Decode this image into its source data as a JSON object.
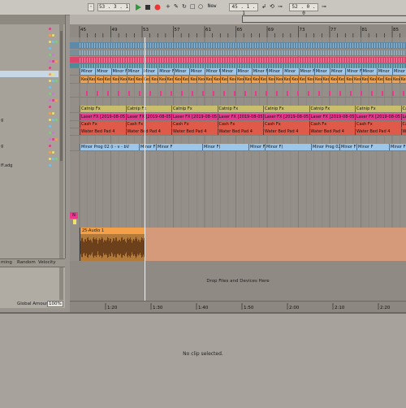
{
  "transport": {
    "tempo": "53 . 3 . 1",
    "new_label": "New",
    "position": "45 . 1 . 1",
    "loop_length": "52 . 0 . 0"
  },
  "browser": {
    "items": [
      "",
      "",
      "",
      "",
      "",
      "",
      "",
      "",
      "",
      "",
      "",
      "",
      "",
      "",
      "g",
      "",
      "",
      "",
      "g",
      "",
      "",
      "ff.adg"
    ]
  },
  "groove": {
    "col_timing": "ming",
    "col_random": "Random",
    "col_velocity": "Velocity",
    "global_amount_label": "Global Amount",
    "global_amount_value": "100%"
  },
  "ruler": {
    "bars": [
      "45",
      "49",
      "53",
      "57",
      "61",
      "65",
      "69",
      "73",
      "77",
      "81",
      "85"
    ]
  },
  "tracks": {
    "minor_clip": "Minor",
    "minor_clip_long": "Minor F",
    "minor_clip_alt": "Minor F(",
    "kex_clip": "Kex",
    "catnip_clip": "Catnip Fx",
    "laser_clip": "Laser FX [2019-08-05 1",
    "laser_clip_short": "Laser FX [2019-08-05 1L",
    "cash_clip": "Cash Fx",
    "water_clip": "Water Bed Pad 4",
    "minor_prog_clip": "Minor Prog 02 (i - v - bV",
    "audio_clip": "25-Audio 1",
    "audio_marker": "N",
    "drop_hint": "Drop Files and Devices Here"
  },
  "timebar": {
    "labels": [
      "1:20",
      "1:30",
      "1:40",
      "1:50",
      "2:00",
      "2:10",
      "2:20"
    ]
  },
  "detail": {
    "empty_message": "No clip selected."
  },
  "colors": {
    "pink": "#e8398e",
    "blue_clip": "#9cc6ea",
    "orange_clip": "#f3a048",
    "olive_clip": "#c8be6c",
    "red_clip": "#e05a4a",
    "audio_clip": "#d9965a",
    "record": "#e33"
  }
}
